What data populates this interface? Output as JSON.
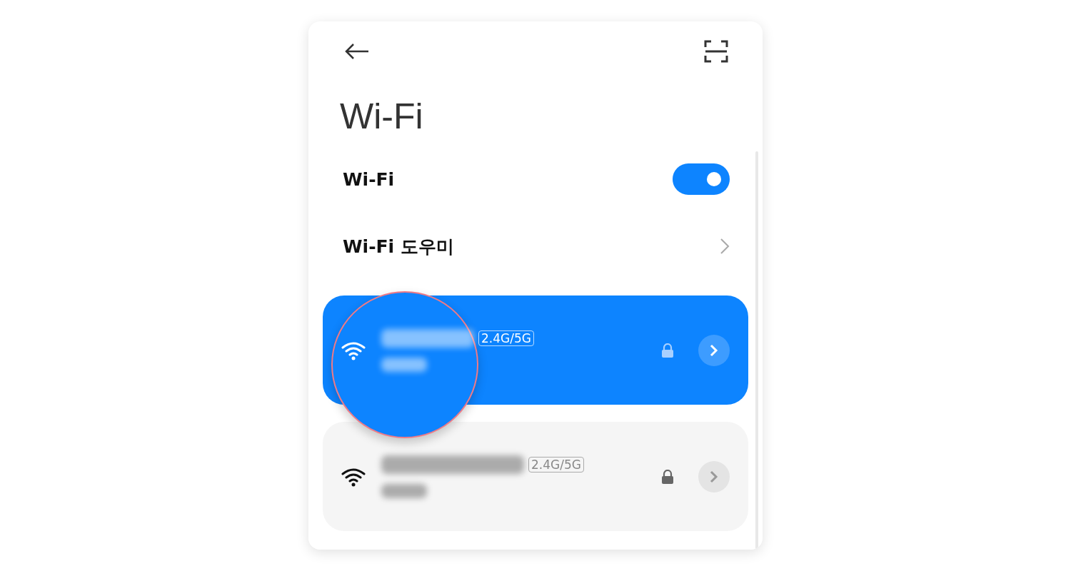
{
  "header": {
    "title": "Wi-Fi"
  },
  "settings": [
    {
      "kind": "toggle",
      "label": "Wi-Fi",
      "on": true
    },
    {
      "kind": "link",
      "label": "Wi-Fi 도우미"
    }
  ],
  "networks": [
    {
      "band": "2.4G/5G",
      "selected": true,
      "locked": true,
      "tapped": true
    },
    {
      "band": "2.4G/5G",
      "selected": false,
      "locked": true,
      "tapped": false
    }
  ]
}
